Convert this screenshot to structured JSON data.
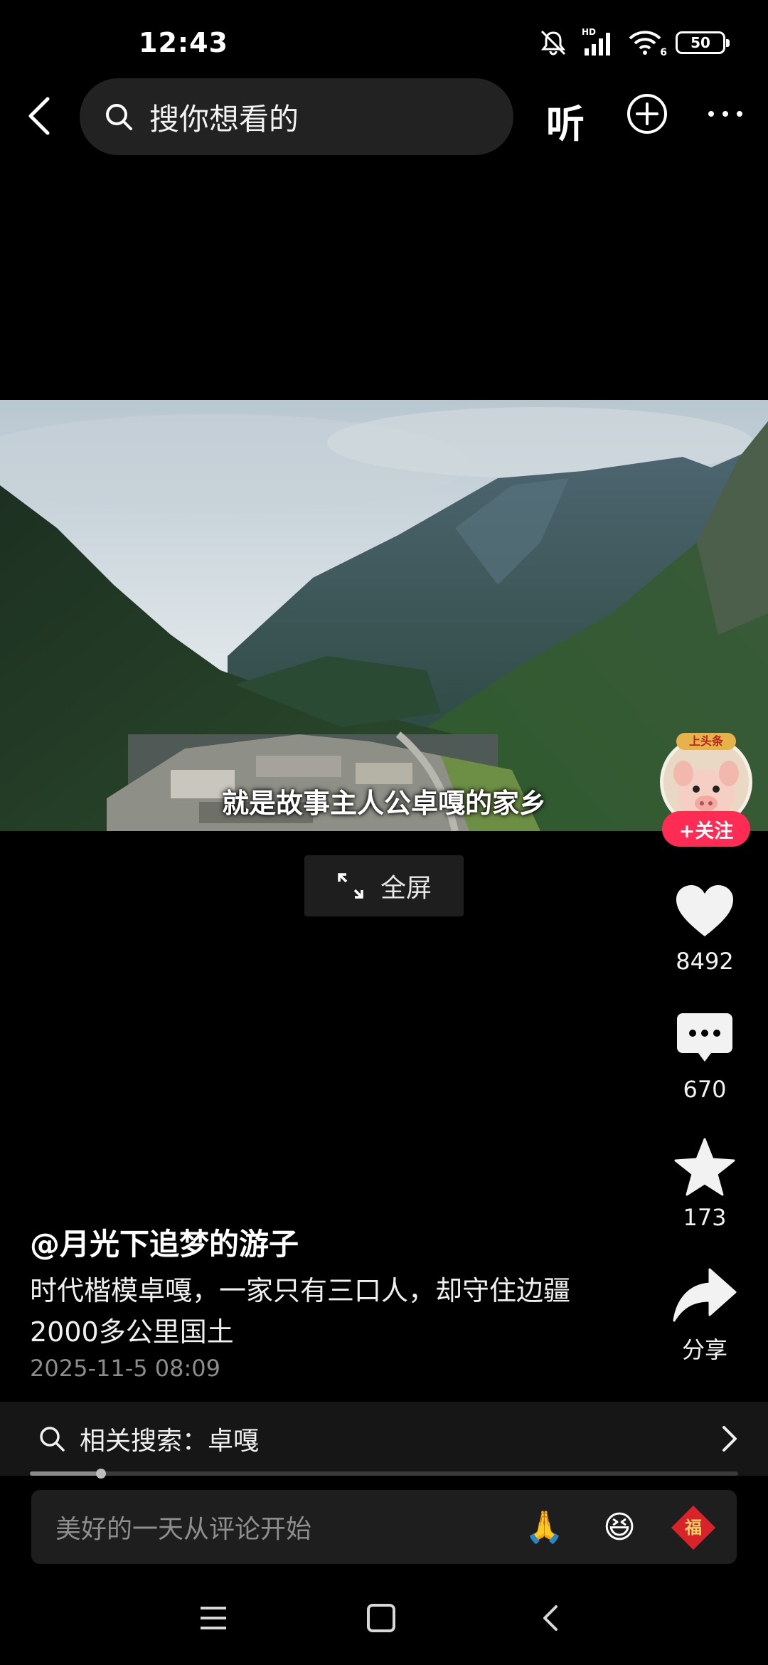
{
  "status_bar": {
    "time": "12:43",
    "network_label": "HD",
    "wifi_label": "6",
    "battery": "50"
  },
  "top_nav": {
    "search_placeholder": "搜你想看的",
    "listen_label": "听"
  },
  "video": {
    "subtitle": "就是故事主人公卓嘎的家乡",
    "fullscreen_label": "全屏"
  },
  "side_rail": {
    "avatar_badge": "上头条",
    "follow_label": "+关注",
    "likes": "8492",
    "comments": "670",
    "favorites": "173",
    "share_label": "分享"
  },
  "post": {
    "author": "@月光下追梦的游子",
    "description": "时代楷模卓嘎，一家只有三口人，却守住边疆2000多公里国土",
    "date": "2025-11-5 08:09"
  },
  "related": {
    "label": "相关搜索：卓嘎"
  },
  "playback": {
    "progress_fraction": 0.1
  },
  "comment_bar": {
    "placeholder": "美好的一天从评论开始",
    "emoji_pray": "🙏",
    "emoji_laugh": "😆",
    "emoji_fu": "福"
  },
  "colors": {
    "accent": "#fe2c55",
    "background": "#000000"
  }
}
